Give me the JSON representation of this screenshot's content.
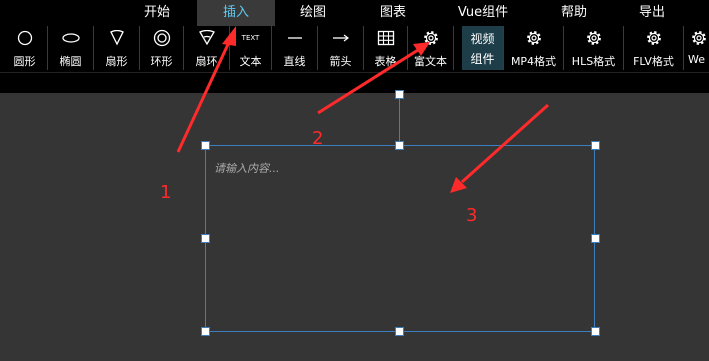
{
  "menu": {
    "items": [
      {
        "label": "开始"
      },
      {
        "label": "插入"
      },
      {
        "label": "绘图"
      },
      {
        "label": "图表"
      },
      {
        "label": "Vue组件"
      },
      {
        "label": "帮助"
      },
      {
        "label": "导出"
      }
    ],
    "active": "插入",
    "active_color": "#5ec8f0"
  },
  "toolbar": {
    "tools": [
      {
        "label": "圆形",
        "icon": "circle-icon"
      },
      {
        "label": "椭圆",
        "icon": "ellipse-icon"
      },
      {
        "label": "扇形",
        "icon": "sector-icon"
      },
      {
        "label": "环形",
        "icon": "ring-icon"
      },
      {
        "label": "扇环",
        "icon": "sector-ring-icon"
      },
      {
        "label": "文本",
        "icon": "text-icon",
        "icon_text": "TEXT"
      },
      {
        "label": "直线",
        "icon": "line-icon"
      },
      {
        "label": "箭头",
        "icon": "arrow-icon"
      },
      {
        "label": "表格",
        "icon": "table-icon"
      },
      {
        "label": "富文本",
        "icon": "gear-icon"
      }
    ],
    "video_group": {
      "line1": "视频",
      "line2": "组件"
    },
    "video_tools": [
      {
        "label": "MP4格式",
        "icon": "gear-icon"
      },
      {
        "label": "HLS格式",
        "icon": "gear-icon"
      },
      {
        "label": "FLV格式",
        "icon": "gear-icon"
      },
      {
        "label": "We",
        "icon": "gear-icon"
      }
    ]
  },
  "canvas": {
    "textbox_placeholder": "请输入内容...",
    "selection_color": "#3b7fc0"
  },
  "annotations": {
    "color": "#ff2a2a",
    "labels": [
      "1",
      "2",
      "3"
    ]
  }
}
